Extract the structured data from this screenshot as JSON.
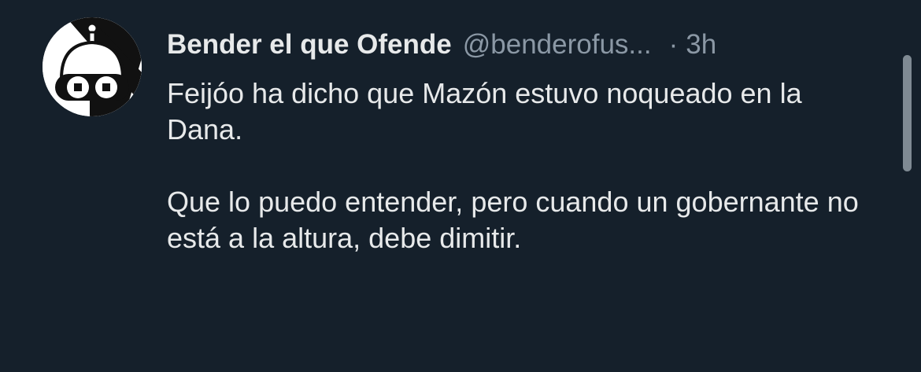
{
  "tweet": {
    "author": {
      "display_name": "Bender el que Ofende",
      "handle": "@benderofus...",
      "avatar_icon": "bender-robot-icon"
    },
    "separator": "·",
    "timestamp": "3h",
    "paragraphs": [
      "Feijóo ha dicho que Mazón estuvo noqueado en la Dana.",
      "Que lo puedo entender, pero cuando un gobernante no está a la altura, debe dimitir."
    ]
  },
  "colors": {
    "background": "#15202b",
    "text_primary": "#e7e9ea",
    "text_secondary": "#8b98a5",
    "scrollbar": "#7f8a93"
  }
}
